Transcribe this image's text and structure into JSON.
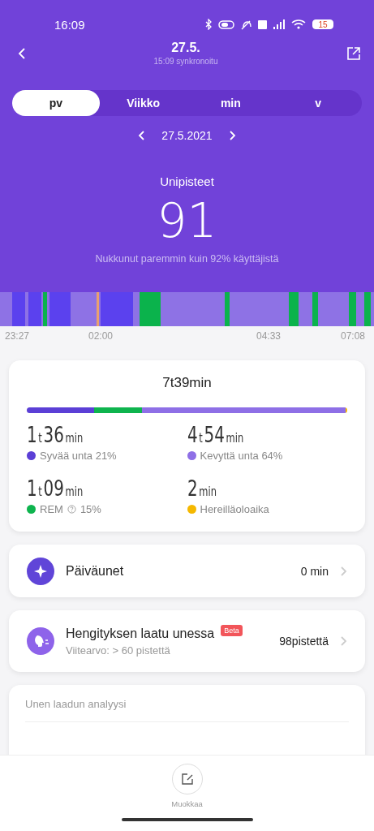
{
  "status_bar": {
    "time": "16:09",
    "battery": "15"
  },
  "header": {
    "title": "27.5.",
    "subtitle": "15:09 synkronoitu"
  },
  "tabs": [
    {
      "label": "pv",
      "selected": true
    },
    {
      "label": "Viikko",
      "selected": false
    },
    {
      "label": "min",
      "selected": false
    },
    {
      "label": "v",
      "selected": false
    }
  ],
  "date": "27.5.2021",
  "score": {
    "label": "Unipisteet",
    "value": "91",
    "caption": "Nukkunut paremmin kuin 92% käyttäjistä"
  },
  "timeline": {
    "labels": [
      "23:27",
      "02:00",
      "04:33",
      "07:08"
    ]
  },
  "summary": {
    "total": "7t39min",
    "stages": [
      {
        "value": [
          {
            "kind": "num",
            "text": "1"
          },
          {
            "kind": "unit",
            "text": "t"
          },
          {
            "kind": "num",
            "text": "36"
          },
          {
            "kind": "unit",
            "text": "min"
          }
        ],
        "label": "Syvää unta 21%",
        "color": "#5b3fd6",
        "help": false
      },
      {
        "value": [
          {
            "kind": "num",
            "text": "4"
          },
          {
            "kind": "unit",
            "text": "t"
          },
          {
            "kind": "num",
            "text": "54"
          },
          {
            "kind": "unit",
            "text": "min"
          }
        ],
        "label": "Kevyttä unta 64%",
        "color": "#8e6fe6",
        "help": false
      },
      {
        "value": [
          {
            "kind": "num",
            "text": "1"
          },
          {
            "kind": "unit",
            "text": "t"
          },
          {
            "kind": "num",
            "text": "09"
          },
          {
            "kind": "unit",
            "text": "min"
          }
        ],
        "label": "REM",
        "extra": "15%",
        "color": "#0eb44e",
        "help": true
      },
      {
        "value": [
          {
            "kind": "num",
            "text": "2"
          },
          {
            "kind": "unit",
            "text": "min"
          }
        ],
        "label": "Hereilläoloaika",
        "color": "#f5b800",
        "help": false
      }
    ]
  },
  "items": [
    {
      "kind": "nap",
      "title": "Päiväunet",
      "value": "0 min"
    },
    {
      "kind": "breath",
      "title": "Hengityksen laatu unessa",
      "badge": "Beta",
      "subtitle": "Viitearvo: > 60 pistettä",
      "value": "98pistettä"
    }
  ],
  "analysis": {
    "title": "Unen laadun analyysi"
  },
  "bottom": {
    "label": "Muokkaa"
  }
}
